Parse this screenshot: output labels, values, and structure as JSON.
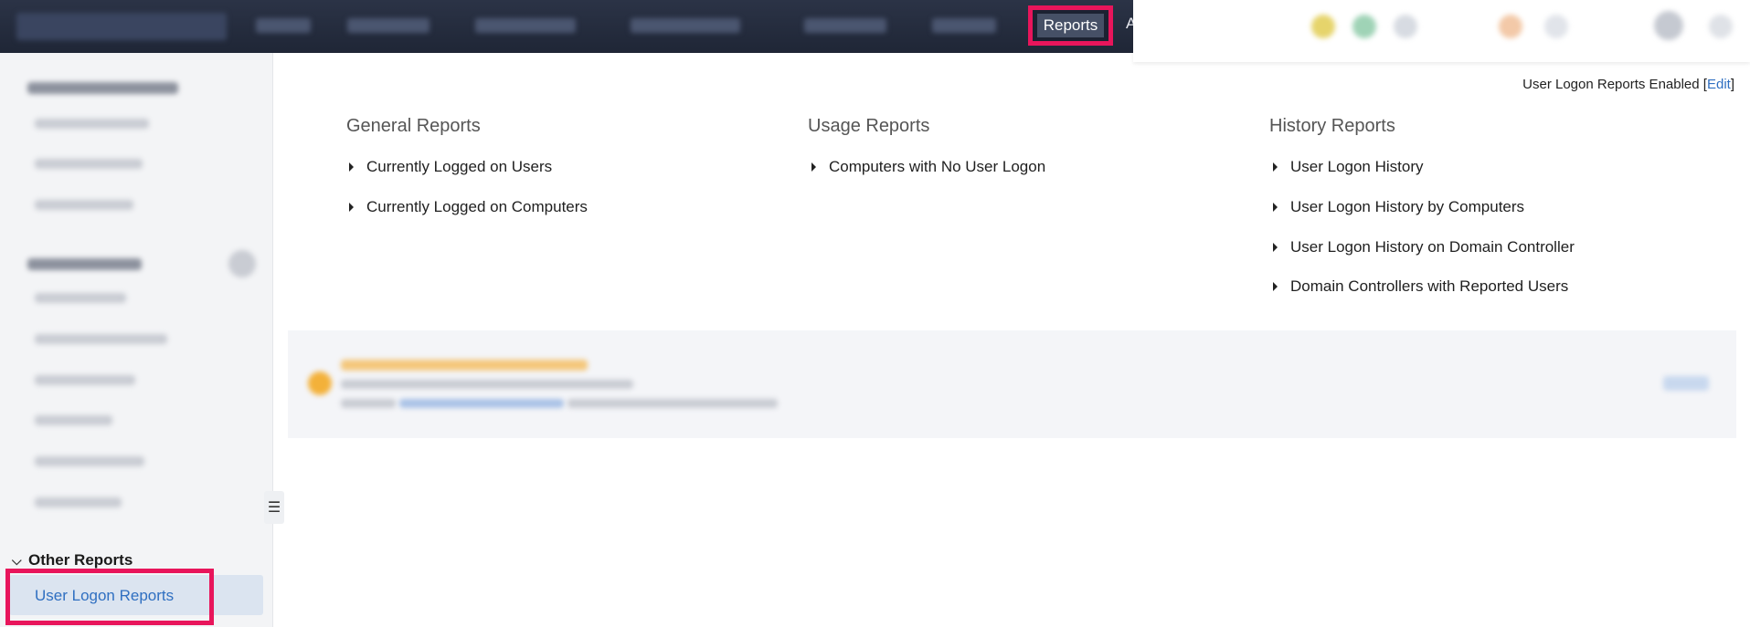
{
  "nav": {
    "active_tab": "Reports",
    "next_tab_partial": "A"
  },
  "sidebar": {
    "section_title": "Other Reports",
    "active_item": "User Logon Reports",
    "collapse_glyph": "☰"
  },
  "status": {
    "text": "User Logon Reports Enabled",
    "open_bracket": "[",
    "edit": "Edit",
    "close_bracket": "]"
  },
  "columns": [
    {
      "title": "General Reports",
      "items": [
        "Currently Logged on Users",
        "Currently Logged on Computers"
      ]
    },
    {
      "title": "Usage Reports",
      "items": [
        "Computers with No User Logon"
      ]
    },
    {
      "title": "History Reports",
      "items": [
        "User Logon History",
        "User Logon History by Computers",
        "User Logon History on Domain Controller",
        "Domain Controllers with Reported Users"
      ]
    }
  ],
  "colors": {
    "highlight": "#e8155b",
    "link": "#2f6fc1",
    "topbar": "#1f2636"
  },
  "icons": {
    "caret": "caret-right-icon",
    "chevron": "chevron-down-icon",
    "collapse": "hamburger-icon"
  }
}
